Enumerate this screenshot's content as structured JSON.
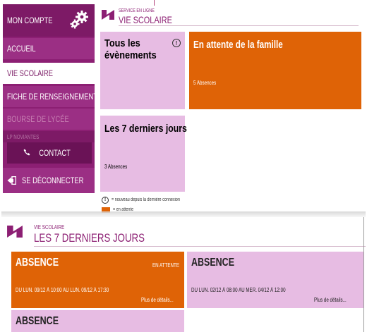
{
  "sidebar": {
    "items": [
      {
        "label": "MON COMPTE"
      },
      {
        "label": "ACCUEIL"
      },
      {
        "label": "VIE SCOLAIRE"
      },
      {
        "label": "FICHE DE RENSEIGNEMENTS"
      },
      {
        "label": "BOURSE DE LYCÉE"
      },
      {
        "label": "LP NOVIANTES"
      }
    ],
    "contact_label": "CONTACT",
    "logout_label": "SE DÉCONNECTER"
  },
  "header": {
    "service_label": "SERVICE EN LIGNE",
    "title": "VIE SCOLAIRE"
  },
  "tiles": {
    "tous": {
      "title": "Tous les évènements"
    },
    "attente": {
      "title": "En attente de la famille",
      "count": "5 Absences"
    },
    "seven": {
      "title": "Les 7 derniers jours",
      "count": "3 Absences"
    }
  },
  "legend": {
    "new_label": "= nouveau depuis la dernière connexion",
    "pending_label": "= en attente"
  },
  "detail": {
    "section_label": "VIE SCOLAIRE",
    "title": "LES 7 DERNIERS JOURS",
    "absences": [
      {
        "title": "ABSENCE",
        "status": "EN ATTENTE",
        "dates": "DU LUN. 09/12 À 10:00 AU LUN. 09/12 À 17:30",
        "more": "Plus de détails..."
      },
      {
        "title": "ABSENCE",
        "status": "",
        "dates": "DU LUN. 02/12 À 08:00 AU MER. 04/12 À 12:00",
        "more": "Plus de détails..."
      },
      {
        "title": "ABSENCE",
        "status": "",
        "dates": "",
        "more": ""
      }
    ]
  },
  "colors": {
    "brand_purple": "#8c1f73",
    "pending_orange": "#df6306",
    "tile_pink": "#e7bce3"
  },
  "icons": [
    "gear-icon",
    "phone-icon",
    "logout-icon",
    "info-icon",
    "logo-icon"
  ]
}
